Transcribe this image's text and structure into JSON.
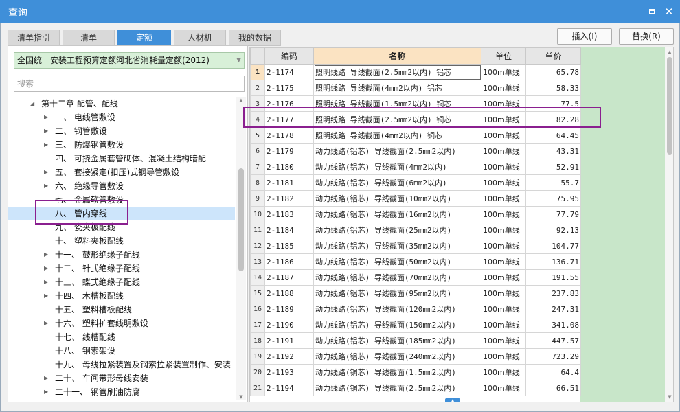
{
  "window": {
    "title": "查询",
    "maximize_icon": "maximize-icon",
    "close_icon": "close-icon",
    "close_glyph": "✕"
  },
  "tabs": [
    {
      "label": "清单指引",
      "active": false
    },
    {
      "label": "清单",
      "active": false
    },
    {
      "label": "定额",
      "active": true
    },
    {
      "label": "人材机",
      "active": false
    },
    {
      "label": "我的数据",
      "active": false
    }
  ],
  "actions": {
    "insert_label": "插入(I)",
    "replace_label": "替换(R)"
  },
  "left_panel": {
    "quota_library": "全国统一安装工程预算定额河北省消耗量定额(2012)",
    "search_placeholder": "搜索",
    "tree": [
      {
        "label": "第十二章 配管、配线",
        "level": 0,
        "arrow": "expanded"
      },
      {
        "label": "一、 电线管敷设",
        "level": 1,
        "arrow": "collapsed"
      },
      {
        "label": "二、 钢管敷设",
        "level": 1,
        "arrow": "collapsed"
      },
      {
        "label": "三、 防爆钢管敷设",
        "level": 1,
        "arrow": "collapsed"
      },
      {
        "label": "四、 可挠金属套管砌体、混凝土结构暗配",
        "level": 1,
        "arrow": "none"
      },
      {
        "label": "五、 套接紧定(扣压)式钢导管敷设",
        "level": 1,
        "arrow": "collapsed"
      },
      {
        "label": "六、 绝缘导管敷设",
        "level": 1,
        "arrow": "collapsed"
      },
      {
        "label": "七、 金属软管敷设",
        "level": 1,
        "arrow": "none"
      },
      {
        "label": "八、 管内穿线",
        "level": 1,
        "arrow": "none",
        "selected": true
      },
      {
        "label": "九、 瓷夹板配线",
        "level": 1,
        "arrow": "none"
      },
      {
        "label": "十、 塑料夹板配线",
        "level": 1,
        "arrow": "none"
      },
      {
        "label": "十一、 鼓形绝缘子配线",
        "level": 1,
        "arrow": "collapsed"
      },
      {
        "label": "十二、 针式绝缘子配线",
        "level": 1,
        "arrow": "collapsed"
      },
      {
        "label": "十三、 蝶式绝缘子配线",
        "level": 1,
        "arrow": "collapsed"
      },
      {
        "label": "十四、 木槽板配线",
        "level": 1,
        "arrow": "collapsed"
      },
      {
        "label": "十五、 塑料槽板配线",
        "level": 1,
        "arrow": "none"
      },
      {
        "label": "十六、 塑料护套线明敷设",
        "level": 1,
        "arrow": "collapsed"
      },
      {
        "label": "十七、 线槽配线",
        "level": 1,
        "arrow": "none"
      },
      {
        "label": "十八、 钢索架设",
        "level": 1,
        "arrow": "none"
      },
      {
        "label": "十九、 母线拉紧装置及钢索拉紧装置制作、安装",
        "level": 1,
        "arrow": "none"
      },
      {
        "label": "二十、 车间带形母线安装",
        "level": 1,
        "arrow": "collapsed"
      },
      {
        "label": "二十一、 钢管刷油防腐",
        "level": 1,
        "arrow": "collapsed"
      }
    ]
  },
  "grid": {
    "columns": {
      "code": "编码",
      "name": "名称",
      "unit": "单位",
      "price": "单价"
    },
    "rows": [
      {
        "n": "1",
        "code": "2-1174",
        "name": "照明线路 导线截面(2.5mm2以内) 铝芯",
        "unit": "100m单线",
        "price": "65.78"
      },
      {
        "n": "2",
        "code": "2-1175",
        "name": "照明线路 导线截面(4mm2以内) 铝芯",
        "unit": "100m单线",
        "price": "58.33"
      },
      {
        "n": "3",
        "code": "2-1176",
        "name": "照明线路 导线截面(1.5mm2以内) 铜芯",
        "unit": "100m单线",
        "price": "77.5"
      },
      {
        "n": "4",
        "code": "2-1177",
        "name": "照明线路 导线截面(2.5mm2以内) 铜芯",
        "unit": "100m单线",
        "price": "82.28"
      },
      {
        "n": "5",
        "code": "2-1178",
        "name": "照明线路 导线截面(4mm2以内) 铜芯",
        "unit": "100m单线",
        "price": "64.45"
      },
      {
        "n": "6",
        "code": "2-1179",
        "name": "动力线路(铝芯) 导线截面(2.5mm2以内)",
        "unit": "100m单线",
        "price": "43.31"
      },
      {
        "n": "7",
        "code": "2-1180",
        "name": "动力线路(铝芯) 导线截面(4mm2以内)",
        "unit": "100m单线",
        "price": "52.91"
      },
      {
        "n": "8",
        "code": "2-1181",
        "name": "动力线路(铝芯) 导线截面(6mm2以内)",
        "unit": "100m单线",
        "price": "55.7"
      },
      {
        "n": "9",
        "code": "2-1182",
        "name": "动力线路(铝芯) 导线截面(10mm2以内)",
        "unit": "100m单线",
        "price": "75.95"
      },
      {
        "n": "10",
        "code": "2-1183",
        "name": "动力线路(铝芯) 导线截面(16mm2以内)",
        "unit": "100m单线",
        "price": "77.79"
      },
      {
        "n": "11",
        "code": "2-1184",
        "name": "动力线路(铝芯) 导线截面(25mm2以内)",
        "unit": "100m单线",
        "price": "92.13"
      },
      {
        "n": "12",
        "code": "2-1185",
        "name": "动力线路(铝芯) 导线截面(35mm2以内)",
        "unit": "100m单线",
        "price": "104.77"
      },
      {
        "n": "13",
        "code": "2-1186",
        "name": "动力线路(铝芯) 导线截面(50mm2以内)",
        "unit": "100m单线",
        "price": "136.71"
      },
      {
        "n": "14",
        "code": "2-1187",
        "name": "动力线路(铝芯) 导线截面(70mm2以内)",
        "unit": "100m单线",
        "price": "191.55"
      },
      {
        "n": "15",
        "code": "2-1188",
        "name": "动力线路(铝芯) 导线截面(95mm2以内)",
        "unit": "100m单线",
        "price": "237.83"
      },
      {
        "n": "16",
        "code": "2-1189",
        "name": "动力线路(铝芯) 导线截面(120mm2以内)",
        "unit": "100m单线",
        "price": "247.31"
      },
      {
        "n": "17",
        "code": "2-1190",
        "name": "动力线路(铝芯) 导线截面(150mm2以内)",
        "unit": "100m单线",
        "price": "341.08"
      },
      {
        "n": "18",
        "code": "2-1191",
        "name": "动力线路(铝芯) 导线截面(185mm2以内)",
        "unit": "100m单线",
        "price": "447.57"
      },
      {
        "n": "19",
        "code": "2-1192",
        "name": "动力线路(铝芯) 导线截面(240mm2以内)",
        "unit": "100m单线",
        "price": "723.29"
      },
      {
        "n": "20",
        "code": "2-1193",
        "name": "动力线路(铜芯) 导线截面(1.5mm2以内)",
        "unit": "100m单线",
        "price": "64.4"
      },
      {
        "n": "21",
        "code": "2-1194",
        "name": "动力线路(铜芯) 导线截面(2.5mm2以内)",
        "unit": "100m单线",
        "price": "66.51"
      }
    ]
  },
  "colors": {
    "accent": "#3f8fd9",
    "highlight_box": "#8a1f8f",
    "green_fill": "#c8e6c9",
    "selection": "#cde5fb"
  }
}
